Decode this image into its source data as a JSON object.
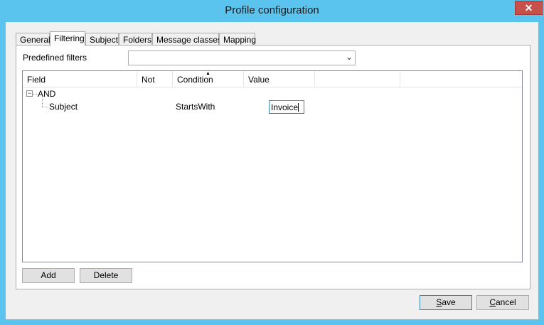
{
  "window": {
    "title": "Profile configuration",
    "close_symbol": "✕"
  },
  "tabs": [
    {
      "label": "General",
      "active": false
    },
    {
      "label": "Filtering",
      "active": true
    },
    {
      "label": "Subject",
      "active": false
    },
    {
      "label": "Folders",
      "active": false
    },
    {
      "label": "Message classes",
      "active": false
    },
    {
      "label": "Mapping",
      "active": false
    }
  ],
  "filtering": {
    "predefined_label": "Predefined filters",
    "predefined_value": "",
    "columns": [
      "Field",
      "Not",
      "Condition",
      "Value"
    ],
    "tree": {
      "root": {
        "field": "AND",
        "expander": "−"
      },
      "children": [
        {
          "field": "Subject",
          "not": "",
          "condition": "StartsWith",
          "value": "Invoice"
        }
      ]
    },
    "add_label": "Add",
    "delete_label": "Delete"
  },
  "footer": {
    "save_first": "S",
    "save_rest": "ave",
    "cancel_first": "C",
    "cancel_rest": "ancel"
  }
}
